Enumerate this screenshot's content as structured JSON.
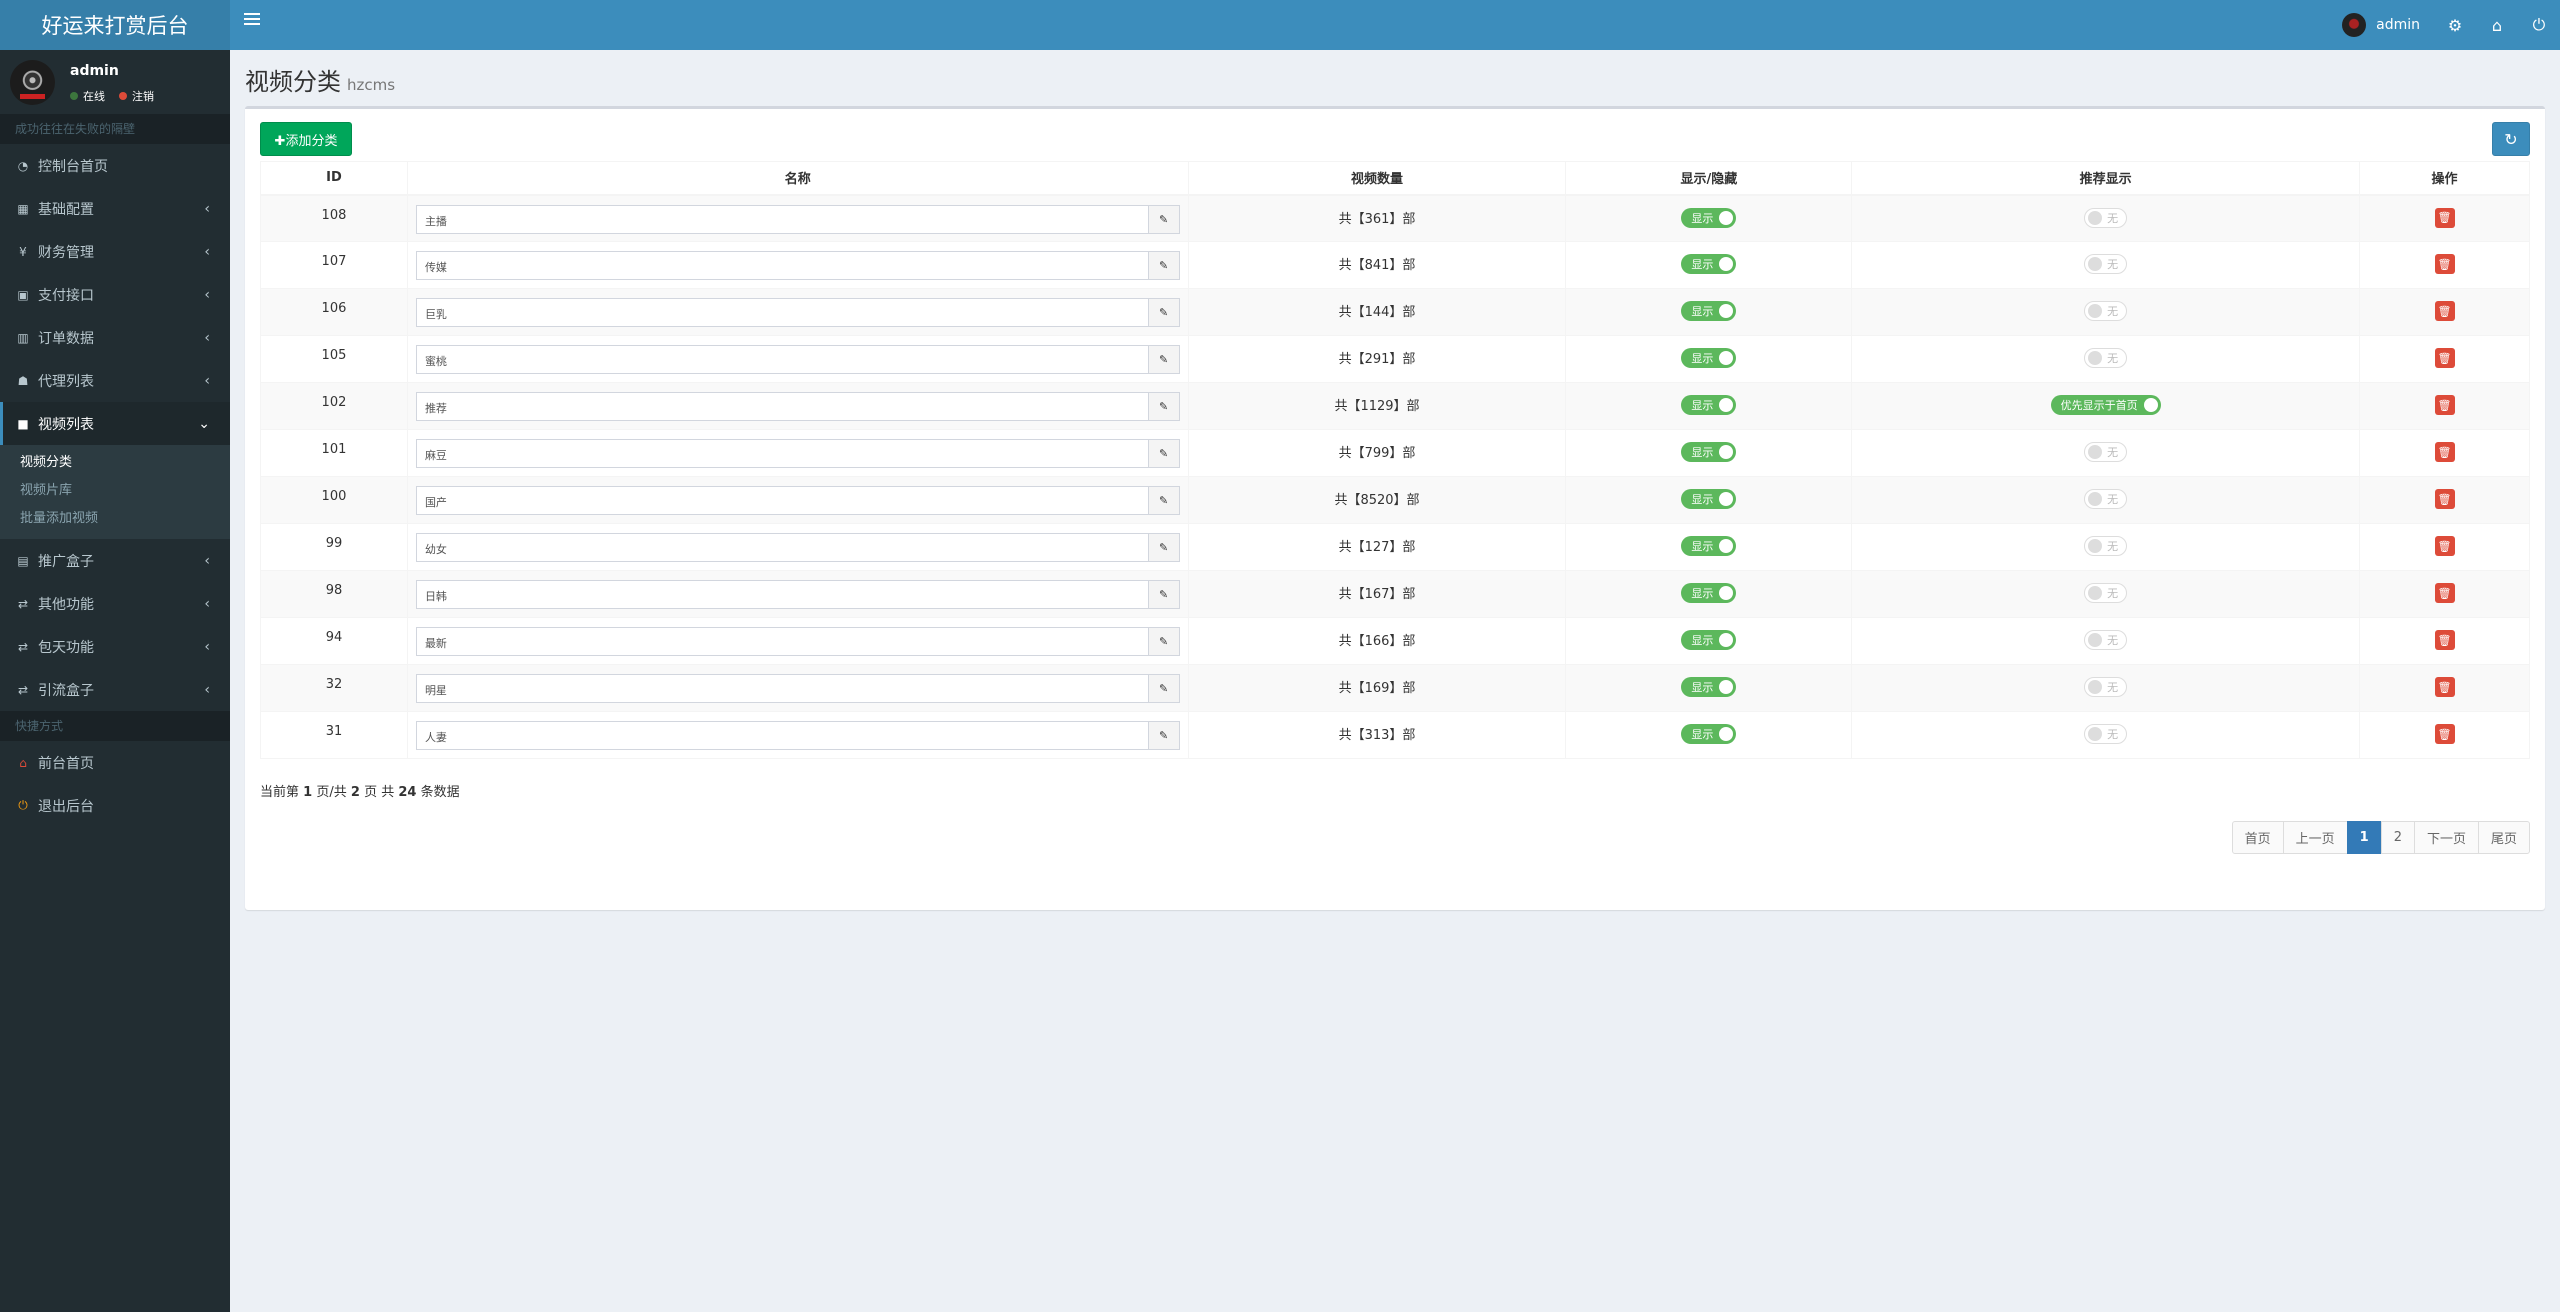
{
  "app": {
    "title": "好运来打赏后台"
  },
  "navbar": {
    "username": "admin"
  },
  "sidebar": {
    "user": {
      "name": "admin",
      "online": "在线",
      "logout": "注销"
    },
    "section_main": "成功往往在失败的隔壁",
    "items": [
      {
        "label": "控制台首页",
        "icon": "dashboard-icon"
      },
      {
        "label": "基础配置",
        "icon": "grid-icon"
      },
      {
        "label": "财务管理",
        "icon": "yen-icon"
      },
      {
        "label": "支付接口",
        "icon": "payment-icon"
      },
      {
        "label": "订单数据",
        "icon": "bar-chart-icon"
      },
      {
        "label": "代理列表",
        "icon": "users-icon"
      },
      {
        "label": "视频列表",
        "icon": "video-icon"
      },
      {
        "label": "推广盒子",
        "icon": "table-icon"
      },
      {
        "label": "其他功能",
        "icon": "retweet-icon"
      },
      {
        "label": "包天功能",
        "icon": "retweet-icon"
      },
      {
        "label": "引流盒子",
        "icon": "retweet-icon"
      }
    ],
    "sub_items": [
      "视频分类",
      "视频片库",
      "批量添加视频"
    ],
    "section_quick": "快捷方式",
    "quick": [
      {
        "label": "前台首页",
        "icon": "home-icon"
      },
      {
        "label": "退出后台",
        "icon": "power-icon"
      }
    ]
  },
  "page": {
    "title": "视频分类",
    "subtitle": "hzcms"
  },
  "toolbar": {
    "add_label": "✚添加分类"
  },
  "table": {
    "headers": [
      "ID",
      "名称",
      "视频数量",
      "显示/隐藏",
      "推荐显示",
      "操作"
    ],
    "rows": [
      {
        "id": "108",
        "name": "主播",
        "count": "共【361】部",
        "show": "显示",
        "rec": "无",
        "rec_on": false
      },
      {
        "id": "107",
        "name": "传媒",
        "count": "共【841】部",
        "show": "显示",
        "rec": "无",
        "rec_on": false
      },
      {
        "id": "106",
        "name": "巨乳",
        "count": "共【144】部",
        "show": "显示",
        "rec": "无",
        "rec_on": false
      },
      {
        "id": "105",
        "name": "蜜桃",
        "count": "共【291】部",
        "show": "显示",
        "rec": "无",
        "rec_on": false
      },
      {
        "id": "102",
        "name": "推荐",
        "count": "共【1129】部",
        "show": "显示",
        "rec": "优先显示于首页",
        "rec_on": true
      },
      {
        "id": "101",
        "name": "麻豆",
        "count": "共【799】部",
        "show": "显示",
        "rec": "无",
        "rec_on": false
      },
      {
        "id": "100",
        "name": "国产",
        "count": "共【8520】部",
        "show": "显示",
        "rec": "无",
        "rec_on": false
      },
      {
        "id": "99",
        "name": "幼女",
        "count": "共【127】部",
        "show": "显示",
        "rec": "无",
        "rec_on": false
      },
      {
        "id": "98",
        "name": "日韩",
        "count": "共【167】部",
        "show": "显示",
        "rec": "无",
        "rec_on": false
      },
      {
        "id": "94",
        "name": "最新",
        "count": "共【166】部",
        "show": "显示",
        "rec": "无",
        "rec_on": false
      },
      {
        "id": "32",
        "name": "明星",
        "count": "共【169】部",
        "show": "显示",
        "rec": "无",
        "rec_on": false
      },
      {
        "id": "31",
        "name": "人妻",
        "count": "共【313】部",
        "show": "显示",
        "rec": "无",
        "rec_on": false
      }
    ]
  },
  "pagination": {
    "info": {
      "prefix": "当前第",
      "current": "1",
      "mid1": "页/共",
      "total_pages": "2",
      "mid2": "页 共",
      "total": "24",
      "suffix": "条数据"
    },
    "buttons": [
      "首页",
      "上一页",
      "1",
      "2",
      "下一页",
      "尾页"
    ],
    "current": "1"
  }
}
